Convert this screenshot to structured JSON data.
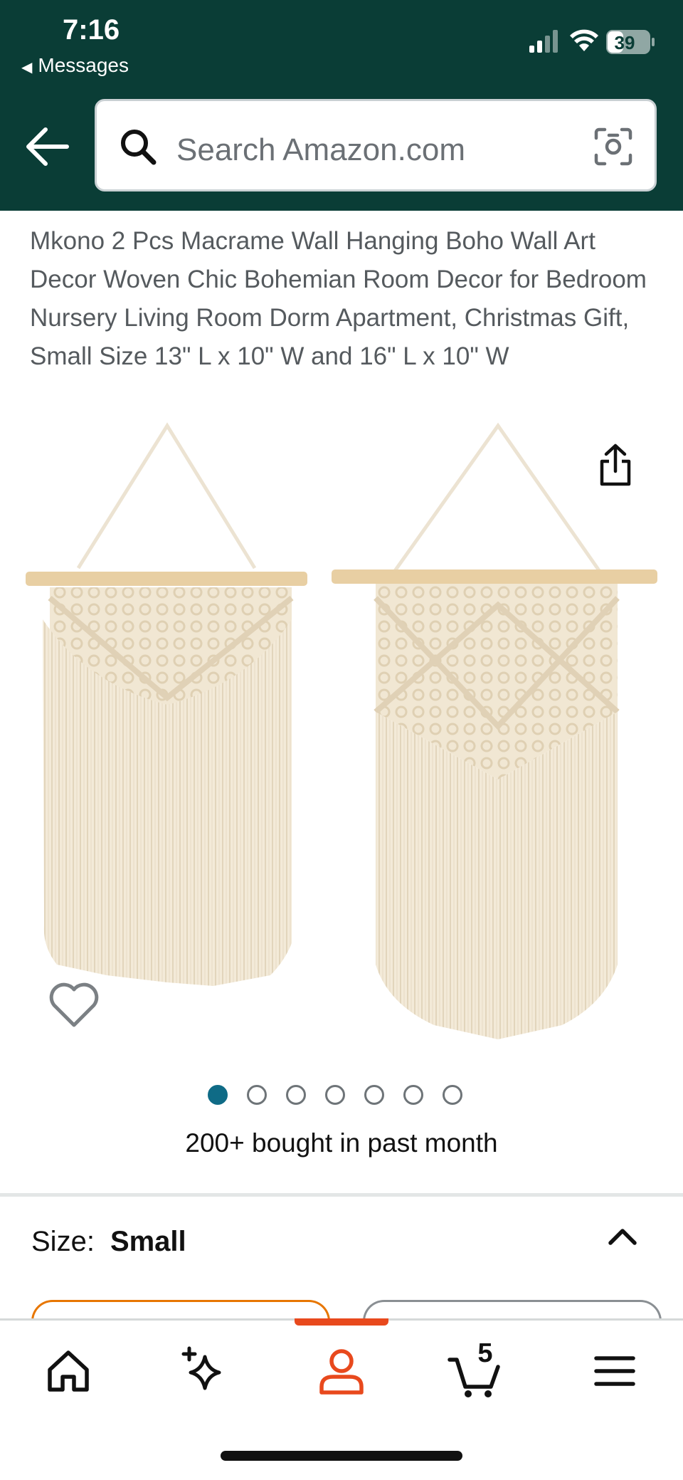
{
  "status_bar": {
    "time": "7:16",
    "back_app": "Messages",
    "battery_percent": "39"
  },
  "header": {
    "background_color": "#0a3d36",
    "back_icon": "back-arrow-icon",
    "search_placeholder": "Search Amazon.com",
    "camera_icon": "camera-scan-icon"
  },
  "product": {
    "title": "Mkono 2 Pcs Macrame Wall Hanging Boho Wall Art Decor Woven Chic Bohemian Room Decor for Bedroom Nursery Living Room Dorm Apartment, Christmas Gift, Small Size 13\" L x 10\" W and 16\" L x 10\" W",
    "image_alt": "Two cream macrame wall hangings on wooden dowels",
    "image_count": 7,
    "active_image_index": 0,
    "bought_text": "200+ bought in past month"
  },
  "size": {
    "label": "Size:",
    "value": "Small"
  },
  "bottom_nav": {
    "items": [
      {
        "name": "home",
        "icon": "home-icon"
      },
      {
        "name": "rufus",
        "icon": "sparkle-icon"
      },
      {
        "name": "account",
        "icon": "person-icon",
        "active": true
      },
      {
        "name": "cart",
        "icon": "cart-icon"
      },
      {
        "name": "menu",
        "icon": "menu-icon"
      }
    ],
    "cart_count": "5",
    "active_color": "#e8491d"
  }
}
